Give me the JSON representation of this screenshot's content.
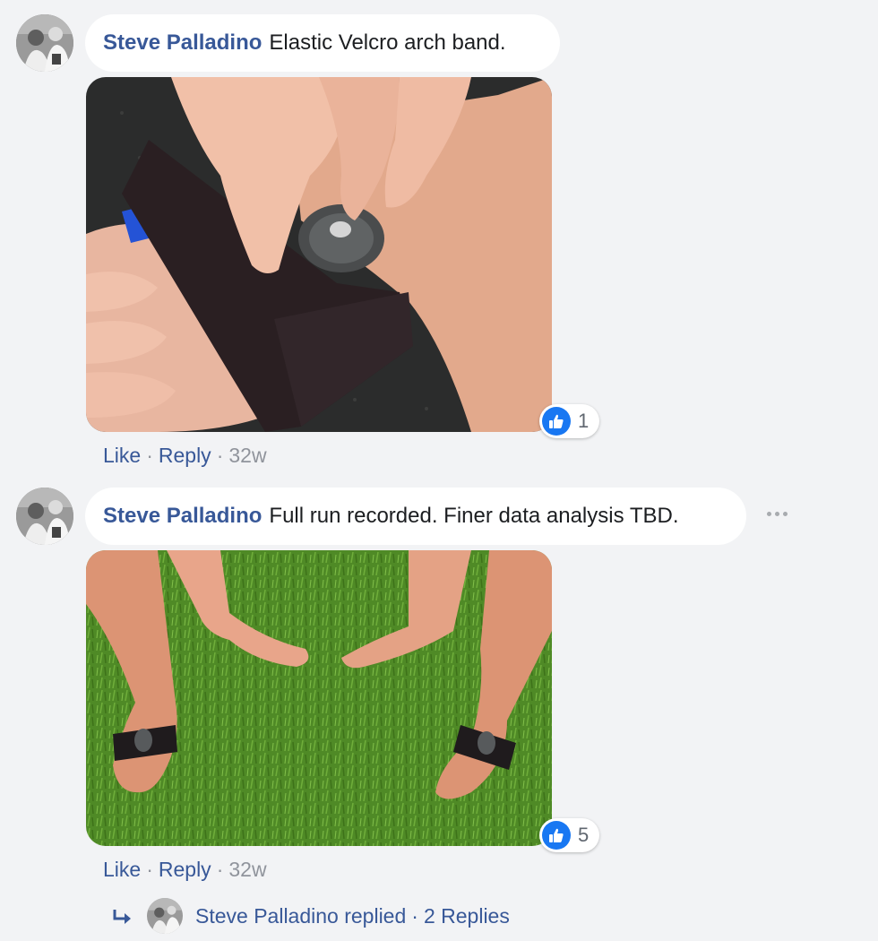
{
  "comments": [
    {
      "author": "Steve Palladino",
      "text": "Elastic Velcro arch band.",
      "reaction_count": "1",
      "actions": {
        "like": "Like",
        "reply": "Reply",
        "time": "32w",
        "separator": "·"
      }
    },
    {
      "author": "Steve Palladino",
      "text": "Full run recorded. Finer data analysis TBD.",
      "reaction_count": "5",
      "actions": {
        "like": "Like",
        "reply": "Reply",
        "time": "32w",
        "separator": "·"
      }
    }
  ],
  "replies_summary": {
    "text": "Steve Palladino replied",
    "separator": "·",
    "count_text": "2 Replies"
  },
  "icons": {
    "like": "thumbs-up-icon",
    "more": "more-options-icon",
    "reply_arrow": "reply-arrow-icon"
  },
  "colors": {
    "background": "#f2f3f5",
    "link": "#385898",
    "like_blue": "#1877f2",
    "muted": "#90949c"
  }
}
